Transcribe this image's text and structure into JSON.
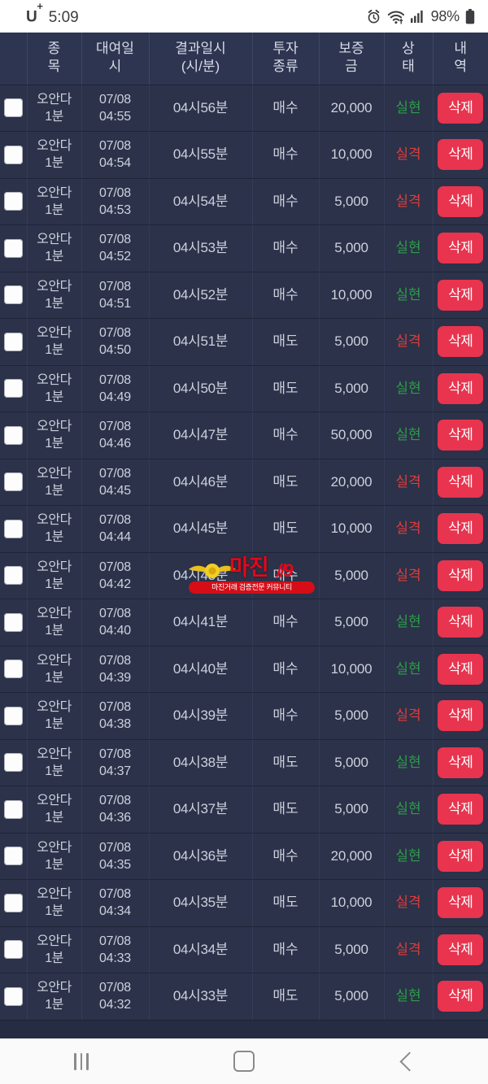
{
  "status_bar": {
    "carrier": "U",
    "carrier_sup": "+",
    "time": "5:09",
    "battery_percent": "98%",
    "icons": [
      "alarm-icon",
      "wifi-icon",
      "signal-icon",
      "battery-icon"
    ]
  },
  "table": {
    "columns": [
      {
        "key": "checkbox",
        "label": ""
      },
      {
        "key": "symbol",
        "label": "종목",
        "line1": "종",
        "line2": "목"
      },
      {
        "key": "lend",
        "label": "대여일시",
        "line1": "대여일",
        "line2": "시"
      },
      {
        "key": "result",
        "label": "결과일시(시/분)",
        "line1": "결과일시",
        "line2": "(시/분)"
      },
      {
        "key": "type",
        "label": "투자종류",
        "line1": "투자",
        "line2": "종류"
      },
      {
        "key": "deposit",
        "label": "보증금",
        "line1": "보증",
        "line2": "금"
      },
      {
        "key": "state",
        "label": "상태",
        "line1": "상",
        "line2": "태"
      },
      {
        "key": "action",
        "label": "내역",
        "line1": "내",
        "line2": "역"
      }
    ],
    "delete_label": "삭제",
    "status_colors": {
      "실현": "#2e9c4a",
      "실격": "#e03c3c"
    },
    "delete_button_color": "#e8344e",
    "header_bg": "#2e3550",
    "row_bg": "#2b3249",
    "rows": [
      {
        "symbol1": "오안다",
        "symbol2": "1분",
        "lend1": "07/08",
        "lend2": "04:55",
        "result": "04시56분",
        "type": "매수",
        "deposit": "20,000",
        "state": "실현",
        "action": "삭제"
      },
      {
        "symbol1": "오안다",
        "symbol2": "1분",
        "lend1": "07/08",
        "lend2": "04:54",
        "result": "04시55분",
        "type": "매수",
        "deposit": "10,000",
        "state": "실격",
        "action": "삭제"
      },
      {
        "symbol1": "오안다",
        "symbol2": "1분",
        "lend1": "07/08",
        "lend2": "04:53",
        "result": "04시54분",
        "type": "매수",
        "deposit": "5,000",
        "state": "실격",
        "action": "삭제"
      },
      {
        "symbol1": "오안다",
        "symbol2": "1분",
        "lend1": "07/08",
        "lend2": "04:52",
        "result": "04시53분",
        "type": "매수",
        "deposit": "5,000",
        "state": "실현",
        "action": "삭제"
      },
      {
        "symbol1": "오안다",
        "symbol2": "1분",
        "lend1": "07/08",
        "lend2": "04:51",
        "result": "04시52분",
        "type": "매수",
        "deposit": "10,000",
        "state": "실현",
        "action": "삭제"
      },
      {
        "symbol1": "오안다",
        "symbol2": "1분",
        "lend1": "07/08",
        "lend2": "04:50",
        "result": "04시51분",
        "type": "매도",
        "deposit": "5,000",
        "state": "실격",
        "action": "삭제"
      },
      {
        "symbol1": "오안다",
        "symbol2": "1분",
        "lend1": "07/08",
        "lend2": "04:49",
        "result": "04시50분",
        "type": "매도",
        "deposit": "5,000",
        "state": "실현",
        "action": "삭제"
      },
      {
        "symbol1": "오안다",
        "symbol2": "1분",
        "lend1": "07/08",
        "lend2": "04:46",
        "result": "04시47분",
        "type": "매수",
        "deposit": "50,000",
        "state": "실현",
        "action": "삭제"
      },
      {
        "symbol1": "오안다",
        "symbol2": "1분",
        "lend1": "07/08",
        "lend2": "04:45",
        "result": "04시46분",
        "type": "매도",
        "deposit": "20,000",
        "state": "실격",
        "action": "삭제"
      },
      {
        "symbol1": "오안다",
        "symbol2": "1분",
        "lend1": "07/08",
        "lend2": "04:44",
        "result": "04시45분",
        "type": "매도",
        "deposit": "10,000",
        "state": "실격",
        "action": "삭제"
      },
      {
        "symbol1": "오안다",
        "symbol2": "1분",
        "lend1": "07/08",
        "lend2": "04:42",
        "result": "04시43분",
        "type": "매수",
        "deposit": "5,000",
        "state": "실격",
        "action": "삭제"
      },
      {
        "symbol1": "오안다",
        "symbol2": "1분",
        "lend1": "07/08",
        "lend2": "04:40",
        "result": "04시41분",
        "type": "매수",
        "deposit": "5,000",
        "state": "실현",
        "action": "삭제"
      },
      {
        "symbol1": "오안다",
        "symbol2": "1분",
        "lend1": "07/08",
        "lend2": "04:39",
        "result": "04시40분",
        "type": "매수",
        "deposit": "10,000",
        "state": "실현",
        "action": "삭제"
      },
      {
        "symbol1": "오안다",
        "symbol2": "1분",
        "lend1": "07/08",
        "lend2": "04:38",
        "result": "04시39분",
        "type": "매수",
        "deposit": "5,000",
        "state": "실격",
        "action": "삭제"
      },
      {
        "symbol1": "오안다",
        "symbol2": "1분",
        "lend1": "07/08",
        "lend2": "04:37",
        "result": "04시38분",
        "type": "매도",
        "deposit": "5,000",
        "state": "실현",
        "action": "삭제"
      },
      {
        "symbol1": "오안다",
        "symbol2": "1분",
        "lend1": "07/08",
        "lend2": "04:36",
        "result": "04시37분",
        "type": "매도",
        "deposit": "5,000",
        "state": "실현",
        "action": "삭제"
      },
      {
        "symbol1": "오안다",
        "symbol2": "1분",
        "lend1": "07/08",
        "lend2": "04:35",
        "result": "04시36분",
        "type": "매수",
        "deposit": "20,000",
        "state": "실현",
        "action": "삭제"
      },
      {
        "symbol1": "오안다",
        "symbol2": "1분",
        "lend1": "07/08",
        "lend2": "04:34",
        "result": "04시35분",
        "type": "매도",
        "deposit": "10,000",
        "state": "실격",
        "action": "삭제"
      },
      {
        "symbol1": "오안다",
        "symbol2": "1분",
        "lend1": "07/08",
        "lend2": "04:33",
        "result": "04시34분",
        "type": "매수",
        "deposit": "5,000",
        "state": "실격",
        "action": "삭제"
      },
      {
        "symbol1": "오안다",
        "symbol2": "1분",
        "lend1": "07/08",
        "lend2": "04:32",
        "result": "04시33분",
        "type": "매도",
        "deposit": "5,000",
        "state": "실현",
        "action": "삭제"
      }
    ]
  },
  "watermark": {
    "title": "마진",
    "mark": "//9",
    "tagline": "마진거래 검증전문 커뮤니티",
    "color": "#e2081a"
  },
  "navbar": {
    "recents_label": "recents-icon",
    "home_label": "home-icon",
    "back_label": "back-icon"
  }
}
